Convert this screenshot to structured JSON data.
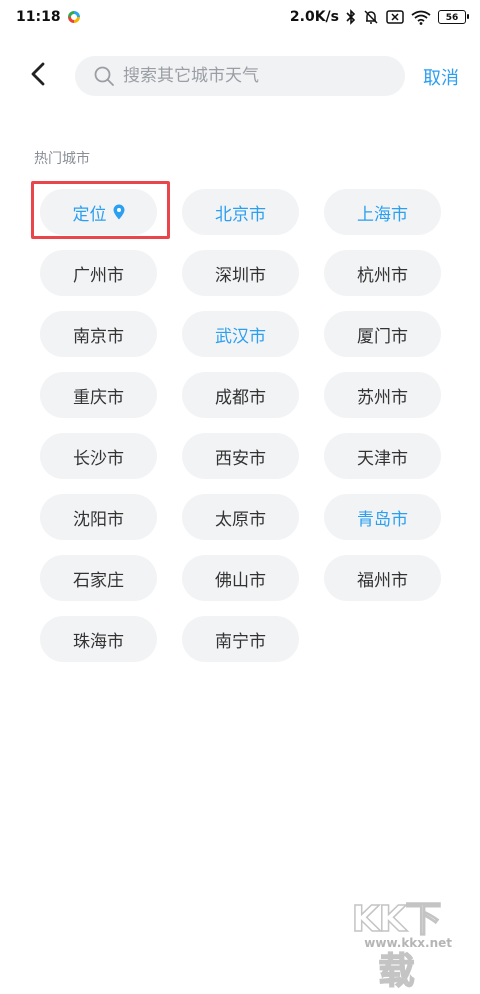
{
  "status_bar": {
    "time": "11:18",
    "network_speed": "2.0K/s",
    "battery": "56",
    "icons": [
      "app-notification-icon",
      "bluetooth-icon",
      "mute-bell-icon",
      "sim-off-icon",
      "wifi-icon",
      "battery-icon"
    ]
  },
  "header": {
    "back_icon": "chevron-left-icon",
    "search_icon": "search-icon",
    "search_placeholder": "搜索其它城市天气",
    "cancel_label": "取消"
  },
  "section": {
    "title": "热门城市"
  },
  "cities": [
    {
      "label": "定位",
      "active": true,
      "icon": "location-pin-icon"
    },
    {
      "label": "北京市",
      "active": true
    },
    {
      "label": "上海市",
      "active": true
    },
    {
      "label": "广州市",
      "active": false
    },
    {
      "label": "深圳市",
      "active": false
    },
    {
      "label": "杭州市",
      "active": false
    },
    {
      "label": "南京市",
      "active": false
    },
    {
      "label": "武汉市",
      "active": true
    },
    {
      "label": "厦门市",
      "active": false
    },
    {
      "label": "重庆市",
      "active": false
    },
    {
      "label": "成都市",
      "active": false
    },
    {
      "label": "苏州市",
      "active": false
    },
    {
      "label": "长沙市",
      "active": false
    },
    {
      "label": "西安市",
      "active": false
    },
    {
      "label": "天津市",
      "active": false
    },
    {
      "label": "沈阳市",
      "active": false
    },
    {
      "label": "太原市",
      "active": false
    },
    {
      "label": "青岛市",
      "active": true
    },
    {
      "label": "石家庄",
      "active": false
    },
    {
      "label": "佛山市",
      "active": false
    },
    {
      "label": "福州市",
      "active": false
    },
    {
      "label": "珠海市",
      "active": false
    },
    {
      "label": "南宁市",
      "active": false
    }
  ],
  "colors": {
    "accent": "#2b9ff0",
    "highlight": "#e8464a",
    "chip_bg": "#f2f3f5"
  },
  "watermark": {
    "logo": "KK下载",
    "url": "www.kkx.net"
  }
}
